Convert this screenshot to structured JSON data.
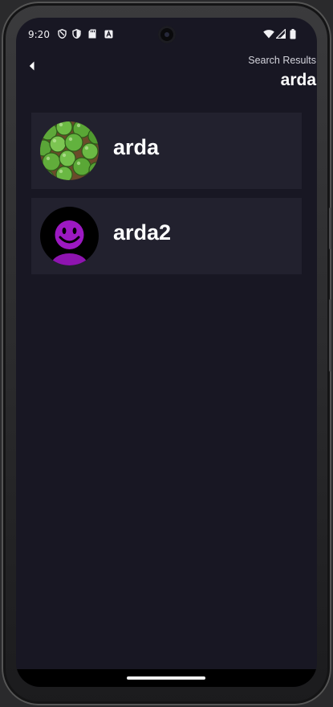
{
  "status_bar": {
    "time": "9:20",
    "left_icons": [
      "shield-outline-icon",
      "shield-half-icon",
      "sd-card-icon",
      "font-a-icon"
    ],
    "right_icons": [
      "wifi-icon",
      "cell-signal-icon",
      "battery-icon"
    ]
  },
  "header": {
    "back_icon": "back-arrow-icon",
    "subtitle": "Search Results",
    "query": "arda"
  },
  "results": [
    {
      "username": "arda",
      "avatar": "green-grapes-photo"
    },
    {
      "username": "arda2",
      "avatar": "purple-smiley"
    }
  ],
  "colors": {
    "background": "#181723",
    "card": "#22212e",
    "text": "#ffffff"
  }
}
